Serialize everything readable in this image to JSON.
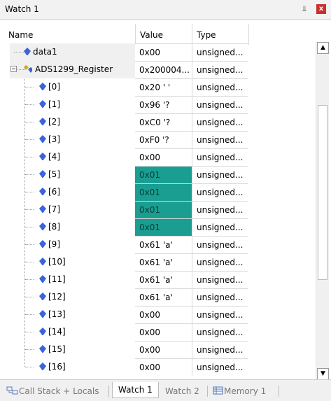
{
  "window": {
    "title": "Watch 1",
    "pin_glyph": "⫫",
    "close_glyph": "x"
  },
  "columns": {
    "name": "Name",
    "value": "Value",
    "type": "Type"
  },
  "rows": [
    {
      "name": "data1",
      "value": "0x00",
      "type": "unsigned...",
      "indent": 0,
      "highlight": false
    },
    {
      "name": "ADS1299_Register",
      "value": "0x200004...",
      "type": "unsigned...",
      "indent": 0,
      "highlight": false,
      "expanded": true
    },
    {
      "name": "[0]",
      "value": "0x20 ' '",
      "type": "unsigned...",
      "indent": 1,
      "highlight": false
    },
    {
      "name": "[1]",
      "value": "0x96 '?",
      "type": "unsigned...",
      "indent": 1,
      "highlight": false
    },
    {
      "name": "[2]",
      "value": "0xC0 '?",
      "type": "unsigned...",
      "indent": 1,
      "highlight": false
    },
    {
      "name": "[3]",
      "value": "0xF0 '?",
      "type": "unsigned...",
      "indent": 1,
      "highlight": false
    },
    {
      "name": "[4]",
      "value": "0x00",
      "type": "unsigned...",
      "indent": 1,
      "highlight": false
    },
    {
      "name": "[5]",
      "value": "0x01",
      "type": "unsigned...",
      "indent": 1,
      "highlight": true
    },
    {
      "name": "[6]",
      "value": "0x01",
      "type": "unsigned...",
      "indent": 1,
      "highlight": true
    },
    {
      "name": "[7]",
      "value": "0x01",
      "type": "unsigned...",
      "indent": 1,
      "highlight": true
    },
    {
      "name": "[8]",
      "value": "0x01",
      "type": "unsigned...",
      "indent": 1,
      "highlight": true
    },
    {
      "name": "[9]",
      "value": "0x61 'a'",
      "type": "unsigned...",
      "indent": 1,
      "highlight": false
    },
    {
      "name": "[10]",
      "value": "0x61 'a'",
      "type": "unsigned...",
      "indent": 1,
      "highlight": false
    },
    {
      "name": "[11]",
      "value": "0x61 'a'",
      "type": "unsigned...",
      "indent": 1,
      "highlight": false
    },
    {
      "name": "[12]",
      "value": "0x61 'a'",
      "type": "unsigned...",
      "indent": 1,
      "highlight": false
    },
    {
      "name": "[13]",
      "value": "0x00",
      "type": "unsigned...",
      "indent": 1,
      "highlight": false
    },
    {
      "name": "[14]",
      "value": "0x00",
      "type": "unsigned...",
      "indent": 1,
      "highlight": false
    },
    {
      "name": "[15]",
      "value": "0x00",
      "type": "unsigned...",
      "indent": 1,
      "highlight": false
    },
    {
      "name": "[16]",
      "value": "0x00",
      "type": "unsigned...",
      "indent": 1,
      "highlight": false
    }
  ],
  "scrollbar": {
    "up_glyph": "▲",
    "down_glyph": "▼"
  },
  "tabs": [
    {
      "label": "Call Stack + Locals",
      "active": false,
      "icon": "call-stack-icon"
    },
    {
      "label": "Watch 1",
      "active": true
    },
    {
      "label": "Watch 2",
      "active": false
    },
    {
      "label": "Memory 1",
      "active": false,
      "icon": "memory-icon"
    }
  ],
  "colors": {
    "highlight": "#1a9e92",
    "gem": "#3a64d8"
  }
}
